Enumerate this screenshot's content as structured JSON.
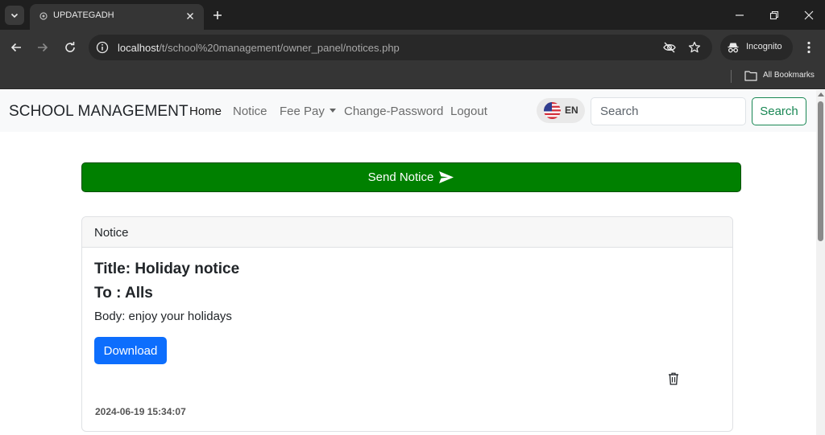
{
  "browser": {
    "tab_title": "UPDATEGADH",
    "url_host": "localhost",
    "url_path": "/t/school%20management/owner_panel/notices.php",
    "incognito_label": "Incognito",
    "bookmarks_label": "All Bookmarks"
  },
  "navbar": {
    "brand": "SCHOOL MANAGEMENT",
    "links": [
      {
        "label": "Home",
        "active": true
      },
      {
        "label": "Notice"
      },
      {
        "label": "Fee Pay",
        "dropdown": true
      },
      {
        "label": "Change-Password"
      },
      {
        "label": "Logout"
      }
    ],
    "language": "EN",
    "search_placeholder": "Search",
    "search_button": "Search"
  },
  "main": {
    "send_notice_label": "Send Notice",
    "notice": {
      "header": "Notice",
      "title": "Title: Holiday notice",
      "to": "To : Alls",
      "body": "Body: enjoy your holidays",
      "download_label": "Download",
      "date": "2024-06-19 15:34:07"
    }
  },
  "colors": {
    "send_button": "#008000",
    "download_button": "#0d6efd",
    "search_button": "#198754"
  }
}
